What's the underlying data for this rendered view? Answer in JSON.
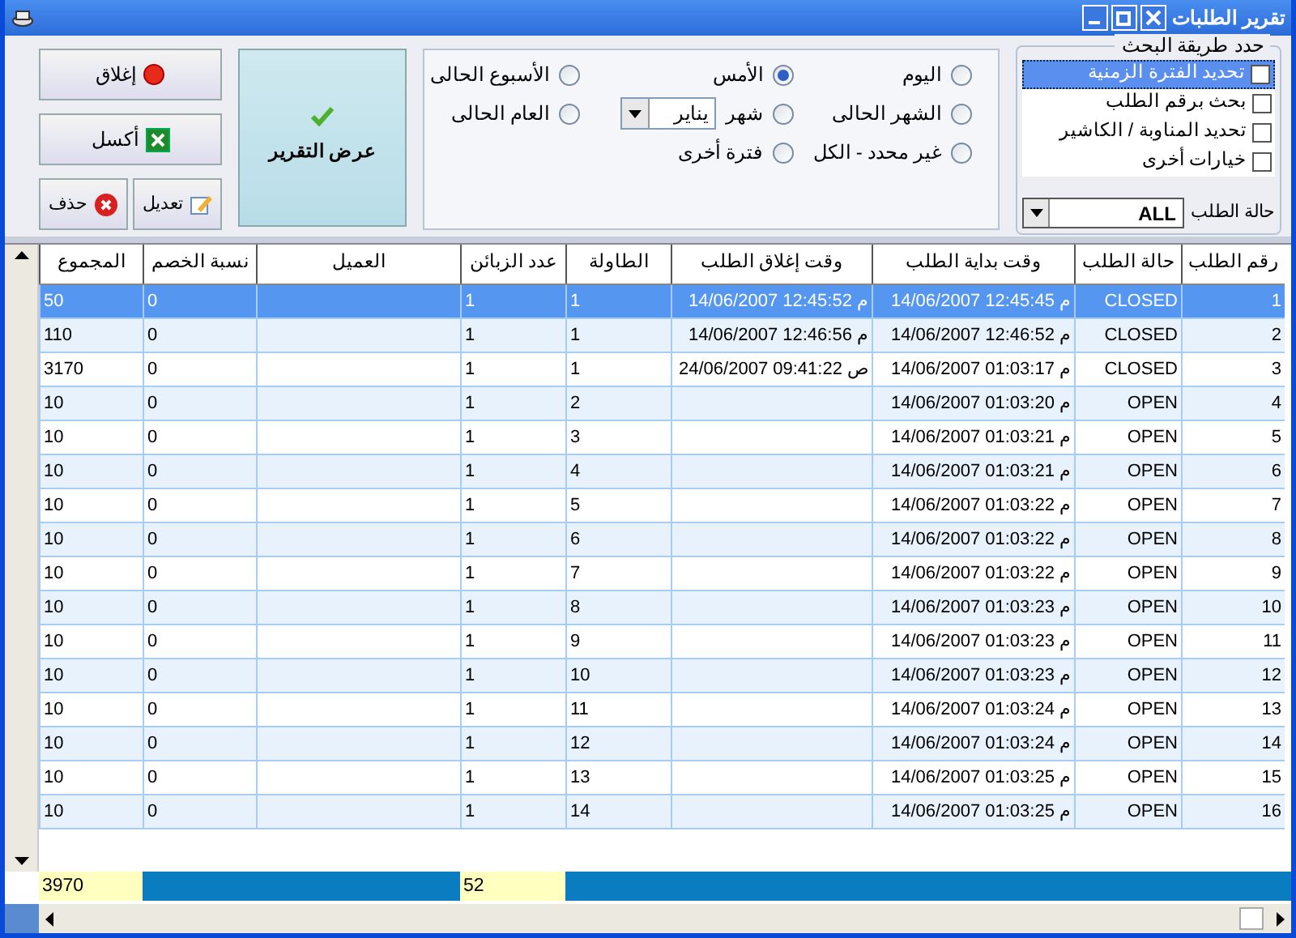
{
  "window": {
    "title": "تقرير الطلبات"
  },
  "search_method": {
    "title": "حدد طريقة البحث",
    "options": [
      {
        "label": "تحديد الفترة الزمنية",
        "checked": false,
        "selected": true
      },
      {
        "label": "بحث برقم الطلب",
        "checked": false,
        "selected": false
      },
      {
        "label": "تحديد المناوبة / الكاشير",
        "checked": false,
        "selected": false
      },
      {
        "label": "خيارات أخرى",
        "checked": false,
        "selected": false
      }
    ],
    "status_label": "حالة الطلب",
    "status_value": "ALL"
  },
  "periods": [
    {
      "label": "اليوم",
      "selected": false
    },
    {
      "label": "الأمس",
      "selected": true
    },
    {
      "label": "الأسبوع الحالى",
      "selected": false
    },
    {
      "label": "الشهر الحالى",
      "selected": false
    },
    {
      "label": "شهر",
      "selected": false,
      "kind": "month",
      "month": "يناير"
    },
    {
      "label": "العام الحالى",
      "selected": false
    },
    {
      "label": "غير محدد - الكل",
      "selected": false
    },
    {
      "label": "فترة أخرى",
      "selected": false
    }
  ],
  "show_report_button": "عرض التقرير",
  "buttons": {
    "close": "إغلاق",
    "excel": "أكسل",
    "edit": "تعديل",
    "delete": "حذف"
  },
  "table": {
    "columns": [
      "رقم الطلب",
      "حالة الطلب",
      "وقت بداية الطلب",
      "وقت إغلاق الطلب",
      "الطاولة",
      "عدد الزبائن",
      "العميل",
      "نسبة الخصم",
      "المجموع"
    ],
    "rows": [
      {
        "selected": true,
        "cells": [
          "1",
          "CLOSED",
          "14/06/2007 12:45:45 م",
          "14/06/2007 12:45:52 م",
          "1",
          "1",
          "",
          "0",
          "50"
        ]
      },
      {
        "selected": false,
        "cells": [
          "2",
          "CLOSED",
          "14/06/2007 12:46:52 م",
          "14/06/2007 12:46:56 م",
          "1",
          "1",
          "",
          "0",
          "110"
        ]
      },
      {
        "selected": false,
        "cells": [
          "3",
          "CLOSED",
          "14/06/2007 01:03:17 م",
          "24/06/2007 09:41:22 ص",
          "1",
          "1",
          "",
          "0",
          "3170"
        ]
      },
      {
        "selected": false,
        "cells": [
          "4",
          "OPEN",
          "14/06/2007 01:03:20 م",
          "",
          "2",
          "1",
          "",
          "0",
          "10"
        ]
      },
      {
        "selected": false,
        "cells": [
          "5",
          "OPEN",
          "14/06/2007 01:03:21 م",
          "",
          "3",
          "1",
          "",
          "0",
          "10"
        ]
      },
      {
        "selected": false,
        "cells": [
          "6",
          "OPEN",
          "14/06/2007 01:03:21 م",
          "",
          "4",
          "1",
          "",
          "0",
          "10"
        ]
      },
      {
        "selected": false,
        "cells": [
          "7",
          "OPEN",
          "14/06/2007 01:03:22 م",
          "",
          "5",
          "1",
          "",
          "0",
          "10"
        ]
      },
      {
        "selected": false,
        "cells": [
          "8",
          "OPEN",
          "14/06/2007 01:03:22 م",
          "",
          "6",
          "1",
          "",
          "0",
          "10"
        ]
      },
      {
        "selected": false,
        "cells": [
          "9",
          "OPEN",
          "14/06/2007 01:03:22 م",
          "",
          "7",
          "1",
          "",
          "0",
          "10"
        ]
      },
      {
        "selected": false,
        "cells": [
          "10",
          "OPEN",
          "14/06/2007 01:03:23 م",
          "",
          "8",
          "1",
          "",
          "0",
          "10"
        ]
      },
      {
        "selected": false,
        "cells": [
          "11",
          "OPEN",
          "14/06/2007 01:03:23 م",
          "",
          "9",
          "1",
          "",
          "0",
          "10"
        ]
      },
      {
        "selected": false,
        "cells": [
          "12",
          "OPEN",
          "14/06/2007 01:03:23 م",
          "",
          "10",
          "1",
          "",
          "0",
          "10"
        ]
      },
      {
        "selected": false,
        "cells": [
          "13",
          "OPEN",
          "14/06/2007 01:03:24 م",
          "",
          "11",
          "1",
          "",
          "0",
          "10"
        ]
      },
      {
        "selected": false,
        "cells": [
          "14",
          "OPEN",
          "14/06/2007 01:03:24 م",
          "",
          "12",
          "1",
          "",
          "0",
          "10"
        ]
      },
      {
        "selected": false,
        "cells": [
          "15",
          "OPEN",
          "14/06/2007 01:03:25 م",
          "",
          "13",
          "1",
          "",
          "0",
          "10"
        ]
      },
      {
        "selected": false,
        "cells": [
          "16",
          "OPEN",
          "14/06/2007 01:03:25 م",
          "",
          "14",
          "1",
          "",
          "0",
          "10"
        ]
      }
    ],
    "totals": {
      "sum": "3970",
      "guests": "52"
    }
  }
}
